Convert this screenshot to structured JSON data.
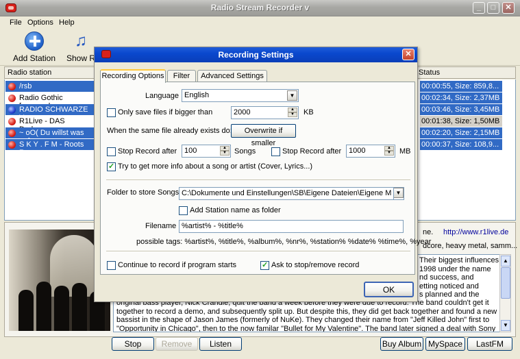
{
  "app": {
    "title": "Radio Stream Recorder v"
  },
  "menu": {
    "file": "File",
    "options": "Options",
    "help": "Help"
  },
  "toolbar": {
    "add_station": "Add Station",
    "show": "Show R"
  },
  "list": {
    "col_station": "Radio station",
    "col_status": "Status",
    "rows": [
      {
        "name": "/rsb",
        "status": "00:00:55, Size: 859,8..."
      },
      {
        "name": "Radio Gothic [www.rad",
        "status": "00:02:34, Size: 2,37MB"
      },
      {
        "name": "RADIO SCHWARZE V",
        "status": "00:03:46, Size: 3,45MB"
      },
      {
        "name": "R1Live - DAS Darkwav",
        "status": "00:01:38, Size: 1,50MB"
      },
      {
        "name": "~ oO( Du willst was auf",
        "status": "00:02:20, Size: 2,15MB"
      },
      {
        "name": "S K Y . F M - Roots Re",
        "status": "00:00:37, Size: 108,9..."
      }
    ]
  },
  "info": {
    "url_prefix": "ne.",
    "url": "http://www.r1live.de",
    "genre": "dcore, heavy metal, samm...",
    "right_lines": [
      "Their biggest influences",
      "1998 under the name",
      "nd success, and",
      "etting noticed and",
      "s planned and the"
    ],
    "desc_lines": [
      "original bass player, Nick Crandle, quit the band a week before they were due to record. The band couldn't get it",
      "together to record a demo, and subsequently split up. But despite this, they did get back together and found a new",
      "bassist in the shape of Jason James (formerly of NuKe). They changed their name from \"Jeff Killed John\" first to",
      "\"Opportunity in Chicago\", then to the now familar \"Bullet for My Valentine\". The band later signed a deal with Sony"
    ]
  },
  "buttons": {
    "stop": "Stop",
    "remove": "Remove",
    "listen": "Listen",
    "buy_album": "Buy Album",
    "myspace": "MySpace",
    "lastfm": "LastFM"
  },
  "dialog": {
    "title": "Recording Settings",
    "tabs": [
      "Recording Options",
      "Filter",
      "Advanced Settings"
    ],
    "language_label": "Language",
    "language_value": "English",
    "only_save_label": "Only save files if bigger than",
    "only_save_value": "2000",
    "only_save_unit": "KB",
    "exists_label": "When the same file already exists do:",
    "exists_value": "Overwrite if smaller",
    "stop_after_label": "Stop Record after",
    "stop_after_songs_value": "100",
    "stop_after_songs_unit": "Songs",
    "stop_after_mb_value": "1000",
    "stop_after_mb_unit": "MB",
    "more_info_label": "Try to get more info about a song or artist (Cover, Lyrics...)",
    "folder_label": "Folder to store Songs",
    "folder_value": "C:\\Dokumente und Einstellungen\\SB\\Eigene Dateien\\Eigene M",
    "add_station_folder_label": "Add Station name as folder",
    "filename_label": "Filename",
    "filename_value": "%artist% - %title%",
    "tags_label": "possible tags: %artist%, %title%, %album%, %nr%, %station% %date% %time%, %year",
    "continue_label": "Continue to record if program starts",
    "ask_stop_label": "Ask to stop/remove record",
    "ok": "OK"
  }
}
